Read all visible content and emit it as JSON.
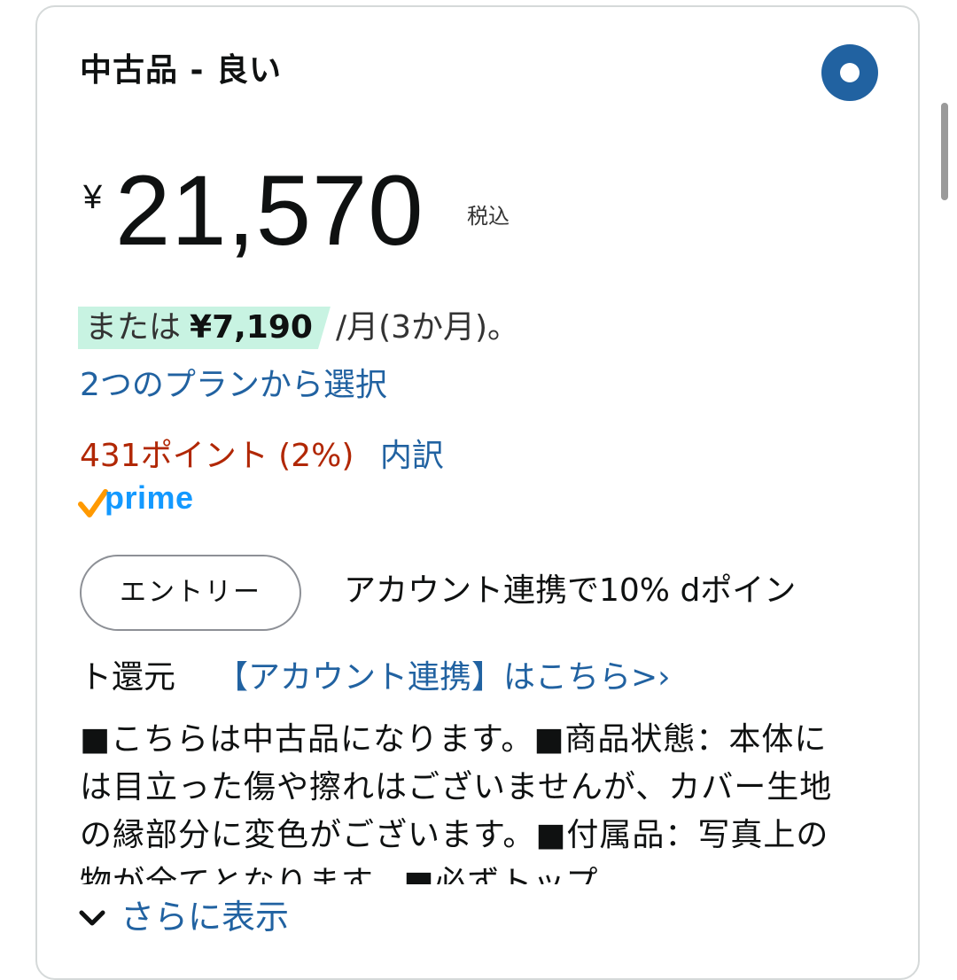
{
  "offer": {
    "condition_title": "中古品 - 良い",
    "price_symbol": "¥",
    "price_value": "21,570",
    "tax_label": "税込",
    "installment_prefix": "または",
    "installment_amount": "¥7,190",
    "installment_suffix": "/月(3か月)。",
    "plan_link": "2つのプランから選択",
    "points_text": "431ポイント (2%)",
    "points_breakdown_link": "内訳",
    "prime_label": "prime"
  },
  "promo": {
    "entry_button": "エントリー",
    "line1": "アカウント連携で10% dポイン",
    "line2": "ト還元",
    "account_link": "【アカウント連携】はこちら>›"
  },
  "description": {
    "text": "■こちらは中古品になります。■商品状態：本体には目立った傷や擦れはございませんが、カバー生地の縁部分に変色がございます。■付属品：写真上の物が全てとなります。■必ずトップ"
  },
  "show_more": {
    "label": "さらに表示"
  },
  "colors": {
    "link": "#2162a1",
    "points": "#b12704",
    "highlight": "#c8f3e2",
    "radio": "#2162a1",
    "prime": "#1399ff",
    "prime_check": "#ff9900"
  }
}
